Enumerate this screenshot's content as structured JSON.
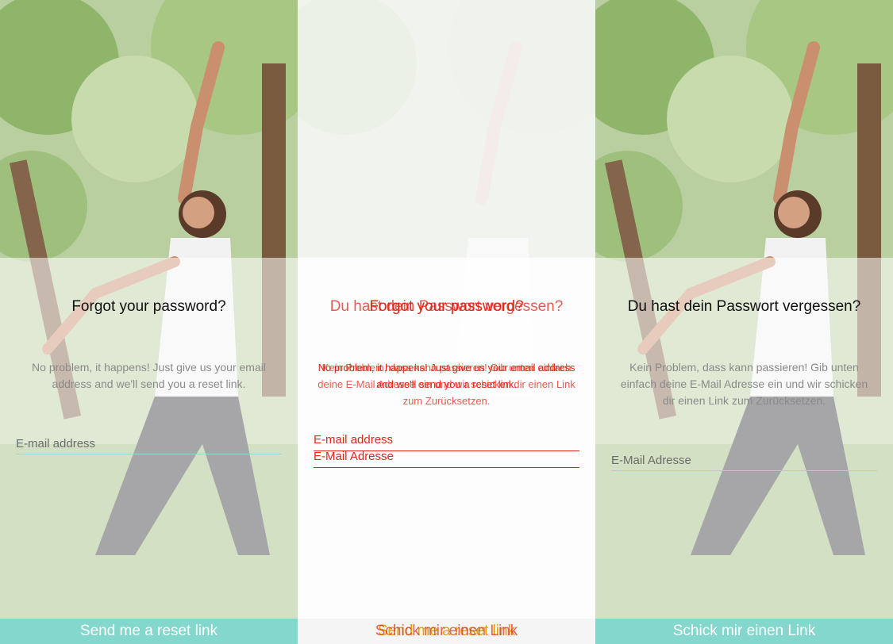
{
  "colors": {
    "accent": "#84d7cc",
    "underline": "#9bd8cf",
    "diff_red": "#e2261a",
    "diff_yellow": "#e0a400"
  },
  "panels": {
    "english": {
      "title": "Forgot your password?",
      "description": "No problem, it happens! Just give us your email address and we'll send you a reset link.",
      "email_placeholder": "E-mail address",
      "button_label": "Send me a reset link"
    },
    "german": {
      "title": "Du hast dein Passwort vergessen?",
      "description": "Kein Problem, dass kann passieren! Gib unten einfach deine E-Mail Adresse ein und wir schicken dir einen Link zum Zurücksetzen.",
      "email_placeholder": "E-Mail Adresse",
      "button_label": "Schick mir einen Link"
    }
  }
}
